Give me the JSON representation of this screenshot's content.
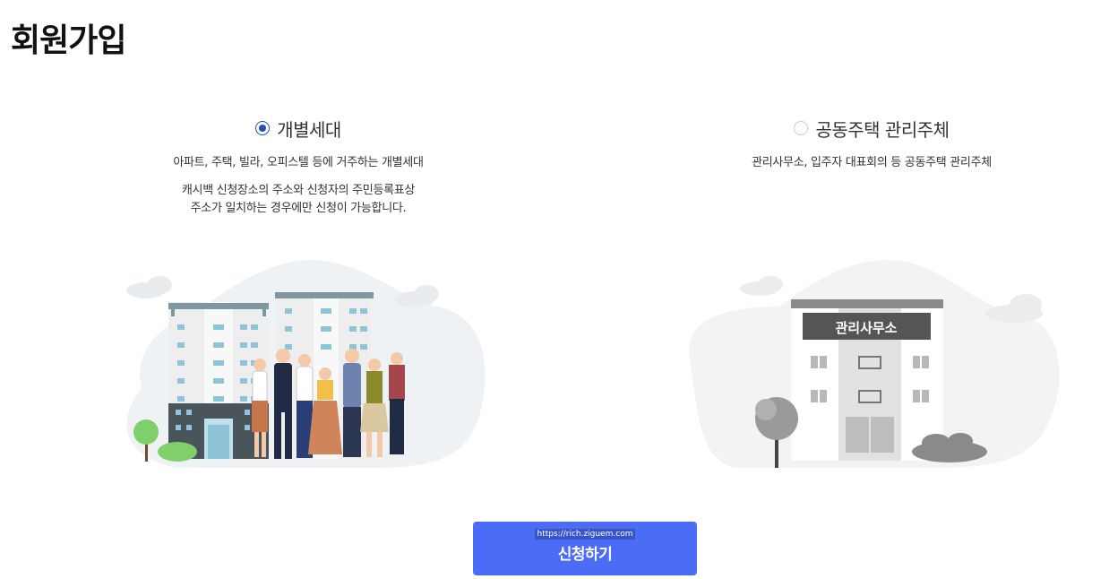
{
  "page": {
    "title": "회원가입"
  },
  "options": [
    {
      "label": "개별세대",
      "selected": true,
      "description": "아파트, 주택, 빌라, 오피스텔 등에 거주하는 개별세대",
      "note_line1": "캐시백 신청장소의 주소와 신청자의 주민등록표상",
      "note_line2": "주소가 일치하는 경우에만 신청이 가능합니다."
    },
    {
      "label": "공동주택 관리주체",
      "selected": false,
      "description": "관리사무소, 입주자 대표회의 등 공동주택 관리주체"
    }
  ],
  "illustration_right": {
    "sign_text": "관리사무소"
  },
  "apply": {
    "url_tag": "https://rich.ziguem.com",
    "label": "신청하기"
  },
  "colors": {
    "accent": "#4a6cf7",
    "radio_checked": "#1f4fc2"
  },
  "icons": {
    "radio_checked": "radio-checked-icon",
    "radio_unchecked": "radio-unchecked-icon"
  }
}
